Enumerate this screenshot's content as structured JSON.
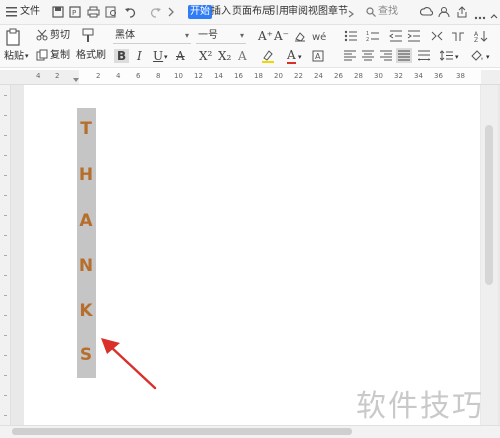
{
  "menubar": {
    "file_label": "文件",
    "tabs": [
      "开始",
      "插入",
      "页面布局",
      "引用",
      "审阅",
      "视图",
      "章节"
    ],
    "search_label": "查找"
  },
  "toolbar": {
    "paste_label": "粘贴",
    "cut_label": "剪切",
    "copy_label": "复制",
    "format_painter_label": "格式刷",
    "font_name": "黑体",
    "font_size": "一号",
    "bold": "B",
    "italic": "I",
    "underline": "U",
    "font_color_glyph": "A",
    "superscript": "X²",
    "subscript": "X₂"
  },
  "ruler": {
    "numbers": [
      "4",
      "2",
      "",
      "2",
      "4",
      "6",
      "8",
      "10",
      "12",
      "14",
      "16",
      "18",
      "20",
      "22",
      "24",
      "26",
      "28",
      "30",
      "32",
      "34",
      "36",
      "38"
    ]
  },
  "document": {
    "vertical_text": [
      "T",
      "H",
      "A",
      "N",
      "K",
      "S"
    ],
    "text_color": "#b66e2c",
    "highlight_color": "#c5c5c5"
  },
  "watermark": "软件技巧",
  "annotation": {
    "arrow_color": "#d9302a"
  }
}
